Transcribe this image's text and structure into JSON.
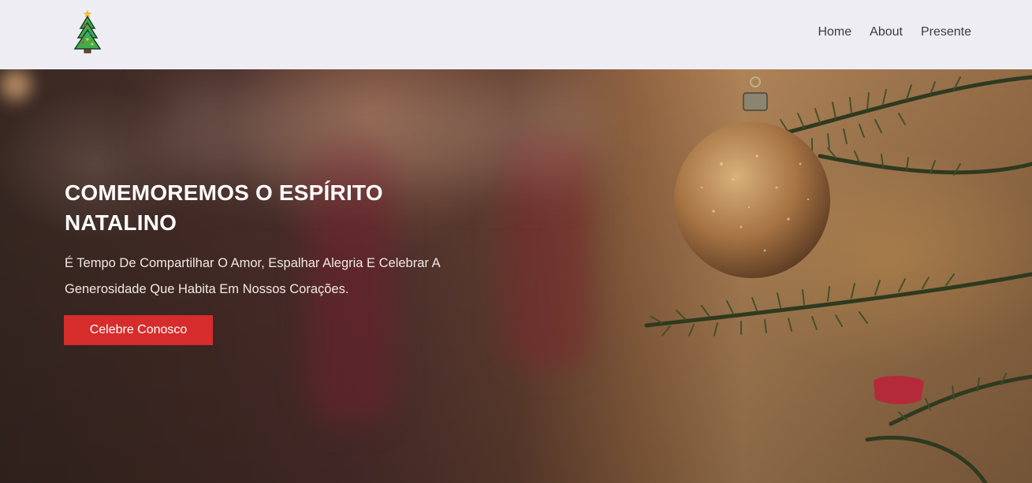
{
  "header": {
    "logo_icon": "christmas-tree-icon",
    "nav": [
      {
        "label": "Home"
      },
      {
        "label": "About"
      },
      {
        "label": "Presente"
      }
    ]
  },
  "hero": {
    "title": "COMEMOREMOS O ESPÍRITO NATALINO",
    "subtitle": "É Tempo De Compartilhar O Amor, Espalhar Alegria E Celebrar A Generosidade Que Habita Em Nossos Corações.",
    "cta_label": "Celebre Conosco",
    "background_image": "christmas-ornament-tree-photo"
  },
  "colors": {
    "header_bg": "#eeedf3",
    "cta_bg": "#d62c2c",
    "text_light": "#ffffff"
  }
}
